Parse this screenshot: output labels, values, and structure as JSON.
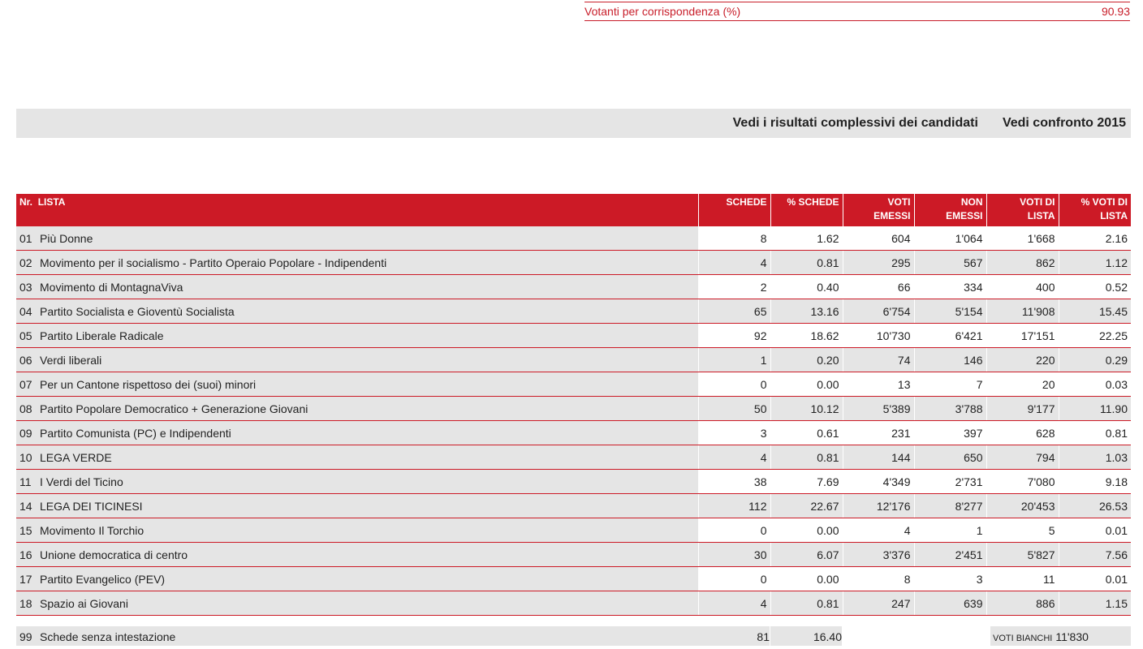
{
  "top": {
    "label": "Votanti per corrispondenza (%)",
    "value": "90.93"
  },
  "links": {
    "candidates": "Vedi i risultati complessivi dei candidati",
    "compare": "Vedi confronto 2015"
  },
  "headers": {
    "nr": "Nr.",
    "lista": "LISTA",
    "schede": "SCHEDE",
    "pct_schede": "% SCHEDE",
    "voti_emessi_1": "VOTI",
    "voti_emessi_2": "EMESSI",
    "non_emessi_1": "NON",
    "non_emessi_2": "EMESSI",
    "voti_lista_1": "VOTI DI",
    "voti_lista_2": "LISTA",
    "pct_voti_1": "% VOTI DI",
    "pct_voti_2": "LISTA"
  },
  "rows": [
    {
      "nr": "01",
      "name": "Più Donne",
      "schede": "8",
      "pct_schede": "1.62",
      "emessi": "604",
      "non_emessi": "1'064",
      "voti_lista": "1'668",
      "pct_voti": "2.16"
    },
    {
      "nr": "02",
      "name": "Movimento per il socialismo - Partito Operaio Popolare - Indipendenti",
      "schede": "4",
      "pct_schede": "0.81",
      "emessi": "295",
      "non_emessi": "567",
      "voti_lista": "862",
      "pct_voti": "1.12"
    },
    {
      "nr": "03",
      "name": "Movimento di MontagnaViva",
      "schede": "2",
      "pct_schede": "0.40",
      "emessi": "66",
      "non_emessi": "334",
      "voti_lista": "400",
      "pct_voti": "0.52"
    },
    {
      "nr": "04",
      "name": "Partito Socialista e Gioventù Socialista",
      "schede": "65",
      "pct_schede": "13.16",
      "emessi": "6'754",
      "non_emessi": "5'154",
      "voti_lista": "11'908",
      "pct_voti": "15.45"
    },
    {
      "nr": "05",
      "name": "Partito Liberale Radicale",
      "schede": "92",
      "pct_schede": "18.62",
      "emessi": "10'730",
      "non_emessi": "6'421",
      "voti_lista": "17'151",
      "pct_voti": "22.25"
    },
    {
      "nr": "06",
      "name": "Verdi liberali",
      "schede": "1",
      "pct_schede": "0.20",
      "emessi": "74",
      "non_emessi": "146",
      "voti_lista": "220",
      "pct_voti": "0.29"
    },
    {
      "nr": "07",
      "name": "Per un Cantone rispettoso dei (suoi) minori",
      "schede": "0",
      "pct_schede": "0.00",
      "emessi": "13",
      "non_emessi": "7",
      "voti_lista": "20",
      "pct_voti": "0.03"
    },
    {
      "nr": "08",
      "name": "Partito Popolare Democratico + Generazione Giovani",
      "schede": "50",
      "pct_schede": "10.12",
      "emessi": "5'389",
      "non_emessi": "3'788",
      "voti_lista": "9'177",
      "pct_voti": "11.90"
    },
    {
      "nr": "09",
      "name": "Partito Comunista (PC) e Indipendenti",
      "schede": "3",
      "pct_schede": "0.61",
      "emessi": "231",
      "non_emessi": "397",
      "voti_lista": "628",
      "pct_voti": "0.81"
    },
    {
      "nr": "10",
      "name": "LEGA VERDE",
      "schede": "4",
      "pct_schede": "0.81",
      "emessi": "144",
      "non_emessi": "650",
      "voti_lista": "794",
      "pct_voti": "1.03"
    },
    {
      "nr": "11",
      "name": "I Verdi del Ticino",
      "schede": "38",
      "pct_schede": "7.69",
      "emessi": "4'349",
      "non_emessi": "2'731",
      "voti_lista": "7'080",
      "pct_voti": "9.18"
    },
    {
      "nr": "14",
      "name": "LEGA DEI TICINESI",
      "schede": "112",
      "pct_schede": "22.67",
      "emessi": "12'176",
      "non_emessi": "8'277",
      "voti_lista": "20'453",
      "pct_voti": "26.53"
    },
    {
      "nr": "15",
      "name": "Movimento Il Torchio",
      "schede": "0",
      "pct_schede": "0.00",
      "emessi": "4",
      "non_emessi": "1",
      "voti_lista": "5",
      "pct_voti": "0.01"
    },
    {
      "nr": "16",
      "name": "Unione democratica di centro",
      "schede": "30",
      "pct_schede": "6.07",
      "emessi": "3'376",
      "non_emessi": "2'451",
      "voti_lista": "5'827",
      "pct_voti": "7.56"
    },
    {
      "nr": "17",
      "name": "Partito Evangelico (PEV)",
      "schede": "0",
      "pct_schede": "0.00",
      "emessi": "8",
      "non_emessi": "3",
      "voti_lista": "11",
      "pct_voti": "0.01"
    },
    {
      "nr": "18",
      "name": "Spazio ai Giovani",
      "schede": "4",
      "pct_schede": "0.81",
      "emessi": "247",
      "non_emessi": "639",
      "voti_lista": "886",
      "pct_voti": "1.15"
    }
  ],
  "bottom": {
    "nr": "99",
    "name": "Schede senza intestazione",
    "schede": "81",
    "pct_schede": "16.40",
    "bianchi_label": "VOTI BIANCHI",
    "bianchi_value": "11'830"
  }
}
